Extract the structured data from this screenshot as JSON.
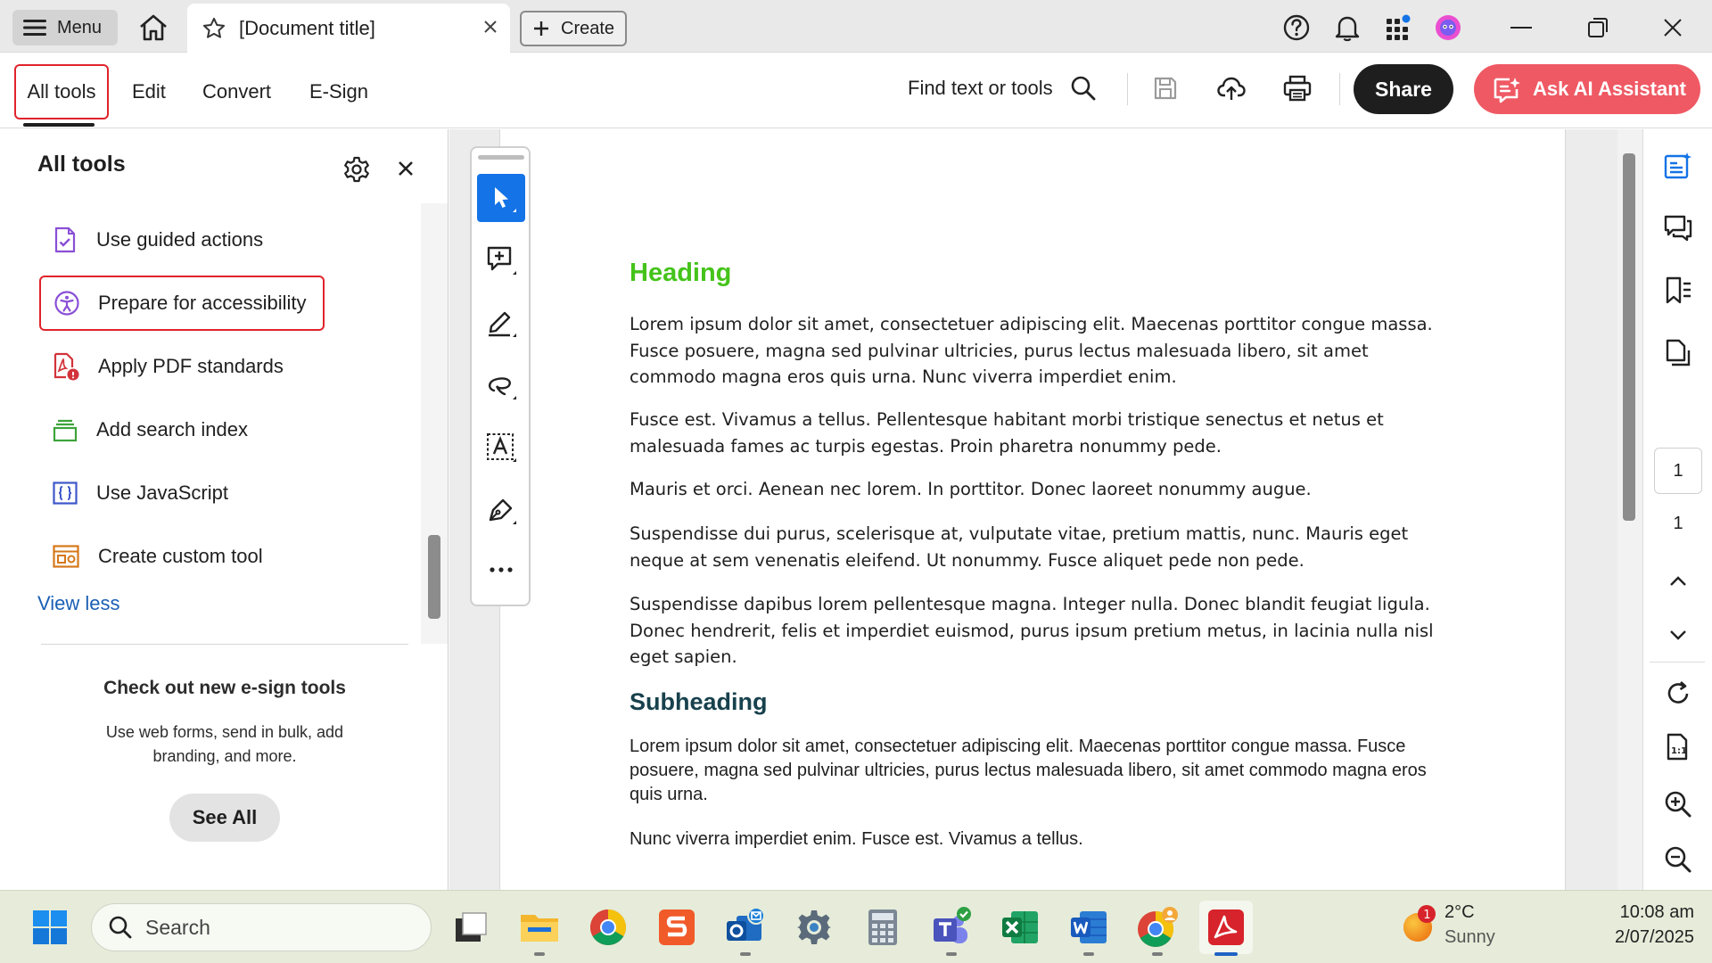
{
  "titlebar": {
    "menu_label": "Menu",
    "doc_title": "[Document title]",
    "create_label": "Create"
  },
  "toolbar": {
    "tabs": [
      "All tools",
      "Edit",
      "Convert",
      "E-Sign"
    ],
    "find_label": "Find text or tools",
    "share_label": "Share",
    "ai_label": "Ask AI Assistant"
  },
  "panel": {
    "title": "All tools",
    "items": [
      {
        "label": "Use guided actions",
        "icon": "guided-actions-icon"
      },
      {
        "label": "Prepare for accessibility",
        "icon": "accessibility-icon"
      },
      {
        "label": "Apply PDF standards",
        "icon": "pdf-standards-icon"
      },
      {
        "label": "Add search index",
        "icon": "search-index-icon"
      },
      {
        "label": "Use JavaScript",
        "icon": "javascript-icon"
      },
      {
        "label": "Create custom tool",
        "icon": "custom-tool-icon"
      }
    ],
    "view_less": "View less",
    "promo_title": "Check out new e-sign tools",
    "promo_text": "Use web forms, send in bulk, add branding, and more.",
    "see_all": "See All"
  },
  "document": {
    "heading": "Heading",
    "paragraphs": [
      "Lorem ipsum dolor sit amet, consectetuer adipiscing elit. Maecenas porttitor congue massa. Fusce posuere, magna sed pulvinar ultricies, purus lectus malesuada libero, sit amet commodo magna eros quis urna. Nunc viverra imperdiet enim.",
      "Fusce est. Vivamus a tellus. Pellentesque habitant morbi tristique senectus et netus et malesuada fames ac turpis egestas. Proin pharetra nonummy pede.",
      "Mauris et orci. Aenean nec lorem. In porttitor. Donec laoreet nonummy augue.",
      "Suspendisse dui purus, scelerisque at, vulputate vitae, pretium mattis, nunc. Mauris eget neque at sem venenatis eleifend. Ut nonummy. Fusce aliquet pede non pede.",
      "Suspendisse dapibus lorem pellentesque magna. Integer nulla. Donec blandit feugiat ligula. Donec hendrerit, felis et imperdiet euismod, purus ipsum pretium metus, in lacinia nulla nisl eget sapien."
    ],
    "subheading": "Subheading",
    "sub_paragraphs": [
      "Lorem ipsum dolor sit amet, consectetuer adipiscing elit. Maecenas porttitor congue massa. Fusce posuere, magna sed pulvinar ultricies, purus lectus malesuada libero, sit amet commodo magna eros quis urna.",
      "Nunc viverra imperdiet enim. Fusce est. Vivamus a tellus."
    ]
  },
  "rightrail": {
    "current_page": "1",
    "total_pages": "1"
  },
  "taskbar": {
    "search_placeholder": "Search",
    "weather_badge": "1",
    "temperature": "2°C",
    "condition": "Sunny",
    "time": "10:08 am",
    "date": "2/07/2025"
  },
  "colors": {
    "accent_red": "#e0232b",
    "ai_button": "#ef5964",
    "heading_green": "#45c31a",
    "subheading_teal": "#17414d",
    "select_blue": "#1473e6"
  }
}
